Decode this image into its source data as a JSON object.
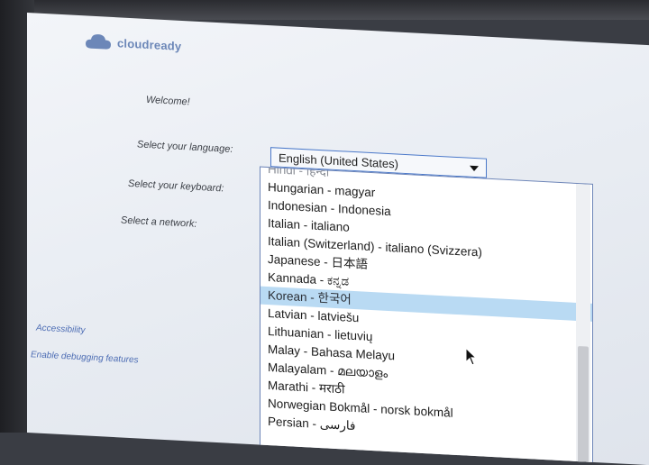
{
  "brand": {
    "name": "cloudready",
    "icon": "cloud-icon",
    "color": "#6c87b8"
  },
  "welcome": {
    "text": "Welcome!"
  },
  "form": {
    "language_label": "Select your language:",
    "keyboard_label": "Select your keyboard:",
    "network_label": "Select a network:",
    "language_selected": "English (United States)"
  },
  "language_options": [
    {
      "label": "Hindi - हिन्दी",
      "state": "partial"
    },
    {
      "label": "Hungarian - magyar",
      "state": "normal"
    },
    {
      "label": "Indonesian - Indonesia",
      "state": "normal"
    },
    {
      "label": "Italian - italiano",
      "state": "normal"
    },
    {
      "label": "Italian (Switzerland) - italiano (Svizzera)",
      "state": "normal"
    },
    {
      "label": "Japanese - 日本語",
      "state": "normal"
    },
    {
      "label": "Kannada - ಕನ್ನಡ",
      "state": "normal"
    },
    {
      "label": "Korean - 한국어",
      "state": "hover"
    },
    {
      "label": "Latvian - latviešu",
      "state": "normal"
    },
    {
      "label": "Lithuanian - lietuvių",
      "state": "normal"
    },
    {
      "label": "Malay - Bahasa Melayu",
      "state": "normal"
    },
    {
      "label": "Malayalam - മലയാളം",
      "state": "normal"
    },
    {
      "label": "Marathi - मराठी",
      "state": "normal"
    },
    {
      "label": "Norwegian Bokmål - norsk bokmål",
      "state": "normal"
    },
    {
      "label": "Persian - فارسی",
      "state": "normal"
    }
  ],
  "links": {
    "accessibility": "Accessibility",
    "debug": "Enable debugging features"
  },
  "colors": {
    "accent": "#4a78c9",
    "hover_row": "#b9daf3",
    "link": "#4d6db4"
  }
}
